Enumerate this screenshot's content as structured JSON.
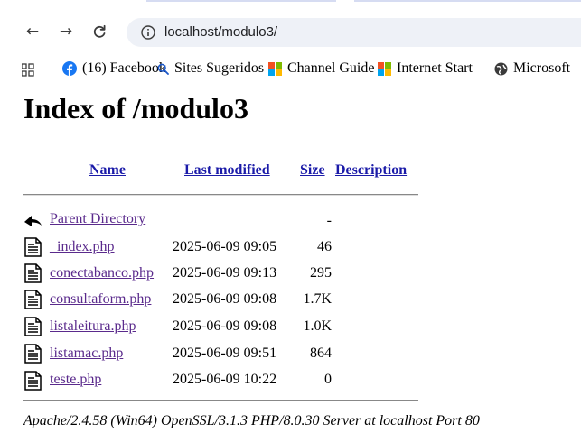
{
  "browser": {
    "url": "localhost/modulo3/",
    "back_glyph": "←",
    "forward_glyph": "→",
    "reload_glyph": "C"
  },
  "bookmarks": [
    {
      "label": "(16) Facebook",
      "icon": "facebook-icon"
    },
    {
      "label": "Sites Sugeridos",
      "icon": "search-icon"
    },
    {
      "label": "Channel Guide",
      "icon": "windows-logo-icon"
    },
    {
      "label": "Internet Start",
      "icon": "windows-logo-icon"
    },
    {
      "label": "Microsoft",
      "icon": "globe-icon"
    }
  ],
  "page": {
    "title": "Index of /modulo3",
    "columns": [
      "Name",
      "Last modified",
      "Size",
      "Description"
    ],
    "parent": {
      "label": "Parent Directory",
      "size": "-"
    },
    "files": [
      {
        "name": "_index.php",
        "modified": "2025-06-09 09:05",
        "size": "46"
      },
      {
        "name": "conectabanco.php",
        "modified": "2025-06-09 09:13",
        "size": "295"
      },
      {
        "name": "consultaform.php",
        "modified": "2025-06-09 09:08",
        "size": "1.7K"
      },
      {
        "name": "listaleitura.php",
        "modified": "2025-06-09 09:08",
        "size": "1.0K"
      },
      {
        "name": "listamac.php",
        "modified": "2025-06-09 09:51",
        "size": "864"
      },
      {
        "name": "teste.php",
        "modified": "2025-06-09 10:22",
        "size": "0"
      }
    ],
    "server_signature": "Apache/2.4.58 (Win64) OpenSSL/3.1.3 PHP/8.0.30 Server at localhost Port 80"
  },
  "colors": {
    "link": "#1a1aa8",
    "visited_link": "#5a2a8c",
    "omnibox_bg": "#eef1f7",
    "facebook_blue": "#1877f2"
  }
}
